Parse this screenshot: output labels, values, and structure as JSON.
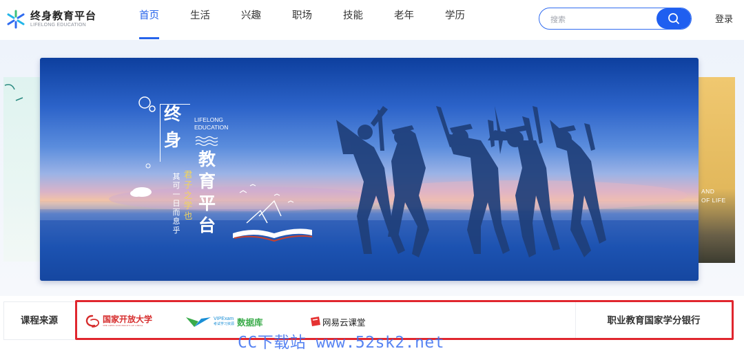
{
  "logo": {
    "title": "终身教育平台",
    "subtitle": "LIFELONG EDUCATION"
  },
  "nav": [
    {
      "label": "首页",
      "active": true
    },
    {
      "label": "生活",
      "active": false
    },
    {
      "label": "兴趣",
      "active": false
    },
    {
      "label": "职场",
      "active": false
    },
    {
      "label": "技能",
      "active": false
    },
    {
      "label": "老年",
      "active": false
    },
    {
      "label": "学历",
      "active": false
    }
  ],
  "search": {
    "placeholder": "搜索",
    "value": ""
  },
  "header": {
    "login_label": "登录"
  },
  "banner": {
    "title_chars": [
      "终",
      "身"
    ],
    "title_chars2": [
      "教",
      "育",
      "平",
      "台"
    ],
    "en_line1": "LIFELONG",
    "en_line2": "EDUCATION",
    "slogan_yellow": "君子之学也",
    "slogan_white": "其可一日而息乎"
  },
  "side_right": {
    "line1": "AND",
    "line2": "OF LIFE"
  },
  "sources": {
    "label": "课程来源",
    "items": [
      {
        "name": "国家开放大学",
        "sub": "THE OPEN UNIVERSITY OF CHINA"
      },
      {
        "name": "数据库",
        "small": "VIPExam",
        "sub": "考试学习资源"
      },
      {
        "name": "网易云课堂"
      }
    ],
    "credit_bank": "职业教育国家学分银行"
  },
  "watermark": "CC下载站 www.52sk2.net",
  "colors": {
    "accent": "#2563eb",
    "highlight_box": "#e0262e"
  }
}
